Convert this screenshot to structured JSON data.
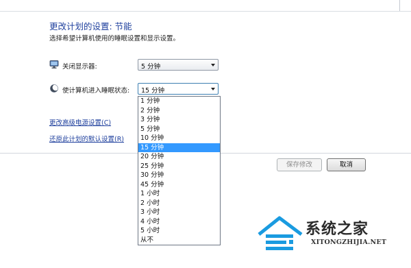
{
  "header": {
    "title": "更改计划的设置: 节能",
    "subtitle": "选择希望计算机使用的睡眠设置和显示设置。"
  },
  "settings": {
    "display_off": {
      "icon": "monitor-icon",
      "label": "关闭显示器:",
      "value": "5 分钟"
    },
    "sleep": {
      "icon": "moon-icon",
      "label": "使计算机进入睡眠状态:",
      "value": "15 分钟",
      "options": [
        "1 分钟",
        "2 分钟",
        "3 分钟",
        "5 分钟",
        "10 分钟",
        "15 分钟",
        "20 分钟",
        "25 分钟",
        "30 分钟",
        "45 分钟",
        "1 小时",
        "2 小时",
        "3 小时",
        "4 小时",
        "5 小时",
        "从不"
      ],
      "selected_index": 5
    }
  },
  "links": {
    "advanced": "更改高级电源设置(C)",
    "restore": "还原此计划的默认设置(R)"
  },
  "buttons": {
    "save": "保存修改",
    "cancel": "取消"
  },
  "watermark": {
    "name": "系统之家",
    "url": "XITONGZHIJIA.NET"
  },
  "colors": {
    "link": "#1e3f9d",
    "selection": "#3399ff",
    "logo_blue": "#1a9be0"
  }
}
